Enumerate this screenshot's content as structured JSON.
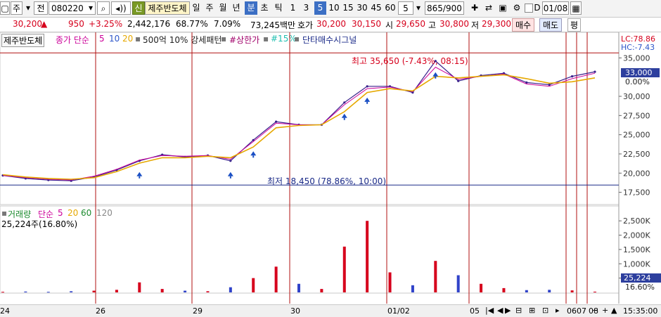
{
  "toolbar": {
    "market": "주",
    "prefix": "전",
    "code": "080220",
    "sin": "신",
    "name": "제주반도체",
    "periods": [
      "일",
      "주",
      "월",
      "년",
      "분",
      "초",
      "틱"
    ],
    "active_period": "분",
    "intervals": [
      "1",
      "3",
      "5",
      "10",
      "15",
      "30",
      "45",
      "60"
    ],
    "active_interval": "5",
    "interval_value": "5",
    "count": "865",
    "count_total": "/900",
    "d_label": "D",
    "date": "01/08"
  },
  "quote": {
    "price": "30,200",
    "change_arrow": "▲",
    "change": "950",
    "change_pct": "+3.25%",
    "volume": "2,442,176",
    "ratio1": "68.77%",
    "ratio2": "7.09%",
    "amount": "73,245백만",
    "ask_label": "호가",
    "ask": "30,200",
    "bid": "30,150",
    "open_label": "시",
    "open": "29,650",
    "high_label": "고",
    "high": "30,800",
    "low_label": "저",
    "low": "29,300",
    "buy": "매수",
    "sell": "매도",
    "even": "평"
  },
  "legend": {
    "stock": "제주반도체",
    "ma_label": "종가 단순",
    "ma": [
      "5",
      "10",
      "20"
    ],
    "signal1": "500억 10% 강세패턴",
    "signal2": "#상한가",
    "signal3": "#15%",
    "signal4": "단타매수시그널"
  },
  "side_labels": {
    "lc": "LC:78.86",
    "hc": "HC:-7.43",
    "cur_price": "33,000",
    "cur_pct": "0.00%",
    "vol_cur": "25,224",
    "vol_pct": "16.60%"
  },
  "volume_legend": {
    "label": "거래량",
    "ma_label": "단순",
    "ma": [
      "5",
      "20",
      "60",
      "120"
    ],
    "current": "25,224주(16.80%)"
  },
  "colors": {
    "price": "#3a1f8c",
    "price_red": "#d6001c",
    "ma5": "#cc0099",
    "ma10": "#2d56c9",
    "ma20": "#e6a800",
    "ma60": "#1b8a2e",
    "vol_up": "#d6001c",
    "vol_down": "#3043c9",
    "signal": "#1a4fc4",
    "divider": "#b01010"
  },
  "chart_data": {
    "type": "line",
    "title": "",
    "xlabel": "",
    "ylabel": "",
    "ylim": [
      16000,
      36500
    ],
    "yticks": [
      17500,
      20000,
      22500,
      25000,
      27500,
      30000,
      35000
    ],
    "ytick_labels": [
      "17,500",
      "20,000",
      "22,500",
      "25,000",
      "27,500",
      "30,000",
      "35,000"
    ],
    "x": [
      "24",
      "24",
      "24",
      "26",
      "26",
      "26",
      "29",
      "29",
      "29",
      "30",
      "30",
      "30",
      "30",
      "30",
      "30",
      "01/02",
      "01/02",
      "01/02",
      "01/02",
      "05",
      "05",
      "05",
      "05",
      "06",
      "07",
      "08",
      "08"
    ],
    "series": [
      {
        "name": "price",
        "values": [
          19700,
          19300,
          19100,
          19000,
          19500,
          20400,
          21600,
          22400,
          22100,
          22300,
          21600,
          24300,
          26700,
          26300,
          26300,
          29200,
          31300,
          31300,
          30500,
          34600,
          32000,
          32700,
          33000,
          31800,
          31500,
          32600,
          33200
        ]
      },
      {
        "name": "5",
        "values": [
          19700,
          19400,
          19200,
          19100,
          19600,
          20500,
          21700,
          22300,
          22200,
          22300,
          21800,
          24100,
          26500,
          26300,
          26300,
          28900,
          31000,
          31200,
          30600,
          33800,
          32200,
          32600,
          32900,
          31600,
          31300,
          32300,
          33000
        ]
      },
      {
        "name": "20",
        "values": [
          19800,
          19500,
          19300,
          19200,
          19400,
          20200,
          21300,
          22000,
          22000,
          22200,
          22000,
          23400,
          25900,
          26200,
          26300,
          28000,
          30500,
          31000,
          30700,
          32600,
          32400,
          32600,
          32800,
          32300,
          31700,
          31900,
          32400
        ]
      }
    ],
    "annotations": [
      {
        "text": "최고 35,650 (-7.43%, 08:15)",
        "value": 35650
      },
      {
        "text": "최저 18,450 (78.86%, 10:00)",
        "value": 18450
      }
    ],
    "date_labels": [
      "24",
      "26",
      "29",
      "30",
      "01/02",
      "05",
      "06",
      "07",
      "08"
    ],
    "volume": {
      "yticks": [
        500000,
        1000000,
        1500000,
        2000000,
        2500000
      ],
      "ytick_labels": [
        "500K",
        "1,000K",
        "1,500K",
        "2,000K",
        "2,500K"
      ],
      "ylim": [
        0,
        2800000
      ],
      "values": [
        20000,
        30000,
        20000,
        40000,
        60000,
        90000,
        350000,
        120000,
        60000,
        40000,
        180000,
        500000,
        900000,
        300000,
        120000,
        1600000,
        2500000,
        700000,
        250000,
        1100000,
        600000,
        300000,
        150000,
        80000,
        90000,
        70000,
        25224
      ]
    }
  },
  "bottom": {
    "time": "15:35:00"
  }
}
